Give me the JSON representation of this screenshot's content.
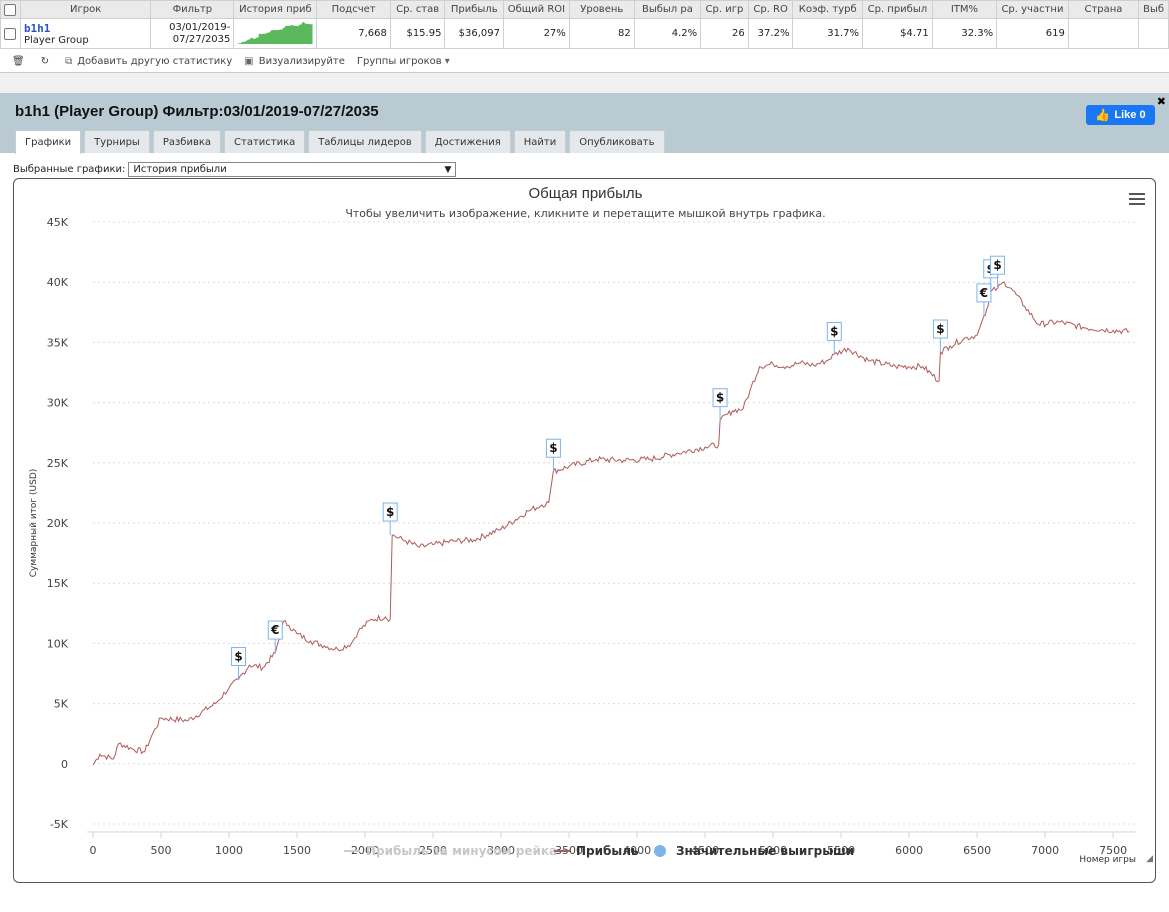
{
  "stats_table": {
    "headers": [
      "Игрок",
      "Фильтр",
      "История приб",
      "Подсчет",
      "Ср. став",
      "Прибыль",
      "Общий ROI",
      "Уровень",
      "Выбыл ра",
      "Ср. игр",
      "Ср. RO",
      "Коэф. турб",
      "Ср. прибыл",
      "ITM%",
      "Ср. участни",
      "Страна",
      "Выб"
    ],
    "row": {
      "player": "b1h1",
      "group": "Player Group",
      "filter_line1": "03/01/2019-",
      "filter_line2": "07/27/2035",
      "count": "7,668",
      "avg_stake": "$15.95",
      "profit": "$36,097",
      "total_roi": "27%",
      "level": "82",
      "late_reg": "4.2%",
      "avg_games": "26",
      "avg_roi": "37.2%",
      "turbo": "31.7%",
      "avg_profit": "$4.71",
      "itm": "32.3%",
      "avg_entrants": "619",
      "country": "",
      "extra": ""
    }
  },
  "toolbar": {
    "add_stat": "Добавить другую статистику",
    "visualize": "Визуализируйте",
    "player_groups": "Группы игроков"
  },
  "panel": {
    "title": "b1h1 (Player Group) Фильтр:03/01/2019-07/27/2035",
    "like_label": "Like 0",
    "tabs": [
      "Графики",
      "Турниры",
      "Разбивка",
      "Статистика",
      "Таблицы лидеров",
      "Достижения",
      "Найти",
      "Опубликовать"
    ],
    "selected_graphs_label": "Выбранные графики:",
    "selected_graph": "История прибыли"
  },
  "colors": {
    "profit_line": "#b05a5a",
    "rake_line": "#cccccc",
    "big_win_marker": "#7cb5ec",
    "header_bg": "#b9cad3",
    "sparkline": "#5cb85c"
  },
  "chart_data": {
    "type": "line",
    "title": "Общая прибыль",
    "subtitle": "Чтобы увеличить изображение, кликните и перетащите мышкой внутрь графика.",
    "ylabel": "Суммарный итог (USD)",
    "xlabel": "Номер игры",
    "xlim": [
      0,
      7668
    ],
    "ylim": [
      -5000,
      45000
    ],
    "x_ticks": [
      0,
      500,
      1000,
      1500,
      2000,
      2500,
      3000,
      3500,
      4000,
      4500,
      5000,
      5500,
      6000,
      6500,
      7000,
      7500
    ],
    "y_ticks": [
      -5000,
      0,
      5000,
      10000,
      15000,
      20000,
      25000,
      30000,
      35000,
      40000,
      45000
    ],
    "y_tick_labels": [
      "-5K",
      "0",
      "5K",
      "10K",
      "15K",
      "20K",
      "25K",
      "30K",
      "35K",
      "40K",
      "45K"
    ],
    "grid": true,
    "legend_position": "bottom",
    "series": [
      {
        "name": "Прибыль за минусом рейка",
        "visible": false,
        "x": [],
        "y": []
      },
      {
        "name": "Прибыль",
        "x": [
          0,
          50,
          150,
          190,
          300,
          380,
          430,
          500,
          700,
          900,
          1000,
          1070,
          1150,
          1250,
          1340,
          1400,
          1440,
          1500,
          1600,
          1700,
          1800,
          1900,
          1950,
          2050,
          2150,
          2185,
          2200,
          2300,
          2400,
          2500,
          2650,
          2800,
          3000,
          3200,
          3300,
          3350,
          3385,
          3500,
          3700,
          3900,
          4100,
          4300,
          4500,
          4600,
          4610,
          4700,
          4780,
          4830,
          4900,
          5000,
          5100,
          5200,
          5300,
          5400,
          5450,
          5550,
          5700,
          5900,
          6100,
          6220,
          6230,
          6300,
          6400,
          6500,
          6550,
          6580,
          6600,
          6650,
          6700,
          6750,
          6850,
          6950,
          7100,
          7300,
          7500,
          7620
        ],
        "y": [
          -100,
          800,
          400,
          1700,
          1200,
          1000,
          2300,
          3800,
          3600,
          5000,
          6300,
          7000,
          8200,
          8000,
          9200,
          11800,
          11500,
          10800,
          10200,
          9800,
          9500,
          10000,
          11000,
          12000,
          12200,
          12000,
          19000,
          18500,
          18000,
          18200,
          18500,
          18600,
          19500,
          21000,
          21500,
          21700,
          24300,
          24700,
          25300,
          25200,
          25300,
          25800,
          26300,
          26500,
          28500,
          29300,
          29500,
          31000,
          33000,
          33200,
          33000,
          33300,
          33100,
          33500,
          34000,
          34500,
          33500,
          33000,
          33000,
          31800,
          34200,
          34700,
          35300,
          35600,
          37200,
          38000,
          39200,
          39500,
          40000,
          39500,
          38000,
          36500,
          36700,
          36200,
          36000,
          35900
        ]
      },
      {
        "name": "Значительные выигрыши",
        "type": "markers",
        "points": [
          {
            "x": 1070,
            "y": 7000,
            "symbol": "$"
          },
          {
            "x": 1340,
            "y": 9200,
            "symbol": "€"
          },
          {
            "x": 2185,
            "y": 19000,
            "symbol": "$"
          },
          {
            "x": 3385,
            "y": 24300,
            "symbol": "$"
          },
          {
            "x": 4610,
            "y": 28500,
            "symbol": "$"
          },
          {
            "x": 5450,
            "y": 34000,
            "symbol": "$"
          },
          {
            "x": 6230,
            "y": 34200,
            "symbol": "$"
          },
          {
            "x": 6550,
            "y": 37200,
            "symbol": "€"
          },
          {
            "x": 6600,
            "y": 39200,
            "symbol": "$"
          },
          {
            "x": 6650,
            "y": 39500,
            "symbol": "$"
          }
        ]
      }
    ]
  }
}
